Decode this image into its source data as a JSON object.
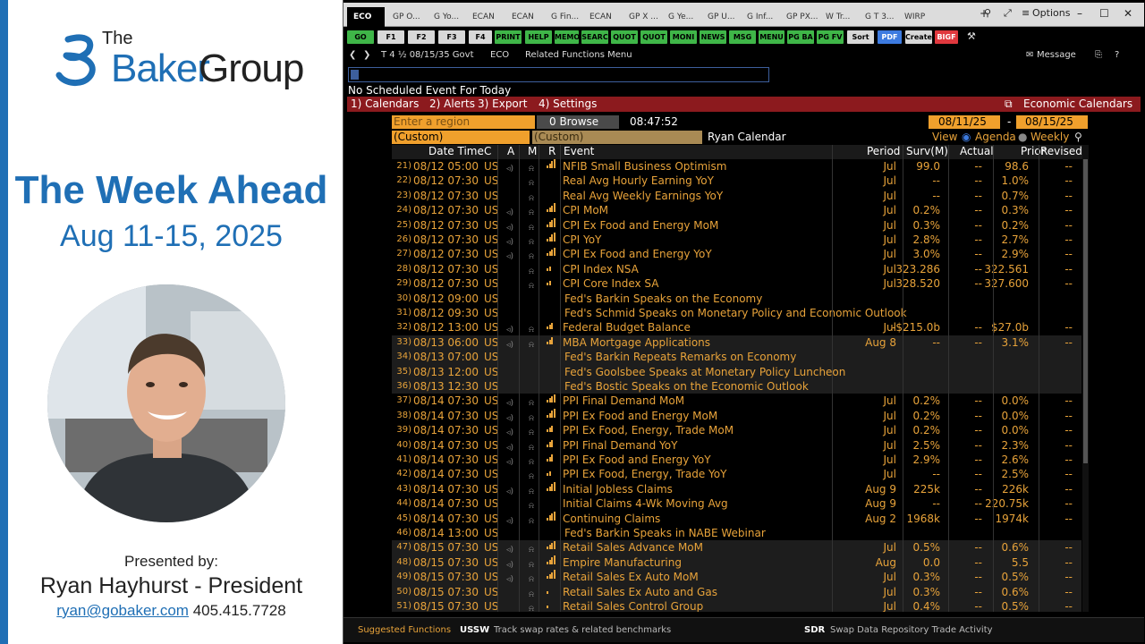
{
  "slide": {
    "logo": {
      "the": "The",
      "baker": "Baker",
      "group": "Group"
    },
    "title": "The Week Ahead",
    "dates": "Aug 11-15, 2025",
    "presented_by": "Presented by:",
    "presenter": "Ryan Hayhurst - President",
    "email": "ryan@gobaker.com",
    "phone": "405.415.7728"
  },
  "terminal": {
    "tabs": [
      "ECO",
      "GP O...",
      "G Yo...",
      "ECAN",
      "ECAN",
      "G Fin...",
      "ECAN",
      "GP X ...",
      "G Ye...",
      "GP U...",
      "G Inf...",
      "GP PX...",
      "W Tr...",
      "G T 3...",
      "WIRP"
    ],
    "options_label": "Options",
    "function_keys": [
      "GO",
      "F1",
      "F2",
      "F3",
      "F4",
      "PRINT",
      "HELP",
      "MEMO",
      "SEARC",
      "QUOT",
      "QUOT",
      "MONI",
      "NEWS",
      "MSG",
      "MENU",
      "PG BA",
      "PG FV",
      "Sort",
      "PDF",
      "Create",
      "BIGF"
    ],
    "nav": {
      "security": "T 4 ½ 08/15/35 Govt",
      "function": "ECO",
      "related": "Related Functions Menu",
      "message": "Message"
    },
    "status_line": "No Scheduled Event For Today",
    "menu": {
      "calendars": "1) Calendars",
      "alerts": "2) Alerts",
      "export": "3) Export",
      "settings": "4) Settings",
      "economic_calendars": "Economic Calendars"
    },
    "region_placeholder": "Enter a region",
    "browse_label": "0 Browse",
    "time": "08:47:52",
    "date_from": "08/11/25",
    "date_to": "08/15/25",
    "custom1": "(Custom)",
    "custom2": "(Custom)",
    "calendar_name": "Ryan Calendar",
    "view_label": "View",
    "agenda_label": "Agenda",
    "weekly_label": "Weekly",
    "columns": {
      "datetime": "Date Time",
      "c": "C",
      "a": "A",
      "m": "M",
      "r": "R",
      "event": "Event",
      "period": "Period",
      "surv": "Surv(M)",
      "actual": "Actual",
      "prior": "Prior",
      "revised": "Revised"
    },
    "rows": [
      {
        "n": "21)",
        "dt": "08/12 05:00",
        "c": "US",
        "ev": "NFIB Small Business Optimism",
        "per": "Jul",
        "sv": "99.0",
        "ac": "--",
        "pr": "98.6",
        "rv": "--",
        "r": 4,
        "shade": false,
        "fed": false
      },
      {
        "n": "22)",
        "dt": "08/12 07:30",
        "c": "US",
        "ev": "Real Avg Hourly Earning YoY",
        "per": "Jul",
        "sv": "--",
        "ac": "--",
        "pr": "1.0%",
        "rv": "--",
        "r": 0,
        "shade": false,
        "fed": false
      },
      {
        "n": "23)",
        "dt": "08/12 07:30",
        "c": "US",
        "ev": "Real Avg Weekly Earnings YoY",
        "per": "Jul",
        "sv": "--",
        "ac": "--",
        "pr": "0.7%",
        "rv": "--",
        "r": 0,
        "shade": false,
        "fed": false
      },
      {
        "n": "24)",
        "dt": "08/12 07:30",
        "c": "US",
        "ev": "CPI MoM",
        "per": "Jul",
        "sv": "0.2%",
        "ac": "--",
        "pr": "0.3%",
        "rv": "--",
        "r": 4,
        "shade": false,
        "fed": false
      },
      {
        "n": "25)",
        "dt": "08/12 07:30",
        "c": "US",
        "ev": "CPI Ex Food and Energy MoM",
        "per": "Jul",
        "sv": "0.3%",
        "ac": "--",
        "pr": "0.2%",
        "rv": "--",
        "r": 4,
        "shade": false,
        "fed": false
      },
      {
        "n": "26)",
        "dt": "08/12 07:30",
        "c": "US",
        "ev": "CPI YoY",
        "per": "Jul",
        "sv": "2.8%",
        "ac": "--",
        "pr": "2.7%",
        "rv": "--",
        "r": 4,
        "shade": false,
        "fed": false
      },
      {
        "n": "27)",
        "dt": "08/12 07:30",
        "c": "US",
        "ev": "CPI Ex Food and Energy YoY",
        "per": "Jul",
        "sv": "3.0%",
        "ac": "--",
        "pr": "2.9%",
        "rv": "--",
        "r": 4,
        "shade": false,
        "fed": false
      },
      {
        "n": "28)",
        "dt": "08/12 07:30",
        "c": "US",
        "ev": "CPI Index NSA",
        "per": "Jul",
        "sv": "323.286",
        "ac": "--",
        "pr": "322.561",
        "rv": "--",
        "r": 2,
        "shade": false,
        "fed": false
      },
      {
        "n": "29)",
        "dt": "08/12 07:30",
        "c": "US",
        "ev": "CPI Core Index SA",
        "per": "Jul",
        "sv": "328.520",
        "ac": "--",
        "pr": "327.600",
        "rv": "--",
        "r": 2,
        "shade": false,
        "fed": false
      },
      {
        "n": "30)",
        "dt": "08/12 09:00",
        "c": "US",
        "ev": "Fed's Barkin Speaks on the Economy",
        "per": "",
        "sv": "",
        "ac": "",
        "pr": "",
        "rv": "",
        "r": 0,
        "shade": false,
        "fed": true
      },
      {
        "n": "31)",
        "dt": "08/12 09:30",
        "c": "US",
        "ev": "Fed's Schmid Speaks on Monetary Policy and Economic Outlook",
        "per": "",
        "sv": "",
        "ac": "",
        "pr": "",
        "rv": "",
        "r": 0,
        "shade": false,
        "fed": true
      },
      {
        "n": "32)",
        "dt": "08/12 13:00",
        "c": "US",
        "ev": "Federal Budget Balance",
        "per": "Jul",
        "sv": "-$215.0b",
        "ac": "--",
        "pr": "$27.0b",
        "rv": "--",
        "r": 3,
        "shade": false,
        "fed": false
      },
      {
        "n": "33)",
        "dt": "08/13 06:00",
        "c": "US",
        "ev": "MBA Mortgage Applications",
        "per": "Aug 8",
        "sv": "--",
        "ac": "--",
        "pr": "3.1%",
        "rv": "--",
        "r": 3,
        "shade": true,
        "fed": false
      },
      {
        "n": "34)",
        "dt": "08/13 07:00",
        "c": "US",
        "ev": "Fed's Barkin Repeats Remarks on Economy",
        "per": "",
        "sv": "",
        "ac": "",
        "pr": "",
        "rv": "",
        "r": 0,
        "shade": true,
        "fed": true
      },
      {
        "n": "35)",
        "dt": "08/13 12:00",
        "c": "US",
        "ev": "Fed's Goolsbee Speaks at Monetary Policy Luncheon",
        "per": "",
        "sv": "",
        "ac": "",
        "pr": "",
        "rv": "",
        "r": 0,
        "shade": true,
        "fed": true
      },
      {
        "n": "36)",
        "dt": "08/13 12:30",
        "c": "US",
        "ev": "Fed's Bostic Speaks on the Economic Outlook",
        "per": "",
        "sv": "",
        "ac": "",
        "pr": "",
        "rv": "",
        "r": 0,
        "shade": true,
        "fed": true
      },
      {
        "n": "37)",
        "dt": "08/14 07:30",
        "c": "US",
        "ev": "PPI Final Demand MoM",
        "per": "Jul",
        "sv": "0.2%",
        "ac": "--",
        "pr": "0.0%",
        "rv": "--",
        "r": 4,
        "shade": false,
        "fed": false
      },
      {
        "n": "38)",
        "dt": "08/14 07:30",
        "c": "US",
        "ev": "PPI Ex Food and Energy MoM",
        "per": "Jul",
        "sv": "0.2%",
        "ac": "--",
        "pr": "0.0%",
        "rv": "--",
        "r": 4,
        "shade": false,
        "fed": false
      },
      {
        "n": "39)",
        "dt": "08/14 07:30",
        "c": "US",
        "ev": "PPI Ex Food, Energy, Trade MoM",
        "per": "Jul",
        "sv": "0.2%",
        "ac": "--",
        "pr": "0.0%",
        "rv": "--",
        "r": 3,
        "shade": false,
        "fed": false
      },
      {
        "n": "40)",
        "dt": "08/14 07:30",
        "c": "US",
        "ev": "PPI Final Demand YoY",
        "per": "Jul",
        "sv": "2.5%",
        "ac": "--",
        "pr": "2.3%",
        "rv": "--",
        "r": 3,
        "shade": false,
        "fed": false
      },
      {
        "n": "41)",
        "dt": "08/14 07:30",
        "c": "US",
        "ev": "PPI Ex Food and Energy YoY",
        "per": "Jul",
        "sv": "2.9%",
        "ac": "--",
        "pr": "2.6%",
        "rv": "--",
        "r": 3,
        "shade": false,
        "fed": false
      },
      {
        "n": "42)",
        "dt": "08/14 07:30",
        "c": "US",
        "ev": "PPI Ex Food, Energy, Trade YoY",
        "per": "Jul",
        "sv": "--",
        "ac": "--",
        "pr": "2.5%",
        "rv": "--",
        "r": 2,
        "shade": false,
        "fed": false
      },
      {
        "n": "43)",
        "dt": "08/14 07:30",
        "c": "US",
        "ev": "Initial Jobless Claims",
        "per": "Aug 9",
        "sv": "225k",
        "ac": "--",
        "pr": "226k",
        "rv": "--",
        "r": 4,
        "shade": false,
        "fed": false
      },
      {
        "n": "44)",
        "dt": "08/14 07:30",
        "c": "US",
        "ev": "Initial Claims 4-Wk Moving Avg",
        "per": "Aug 9",
        "sv": "--",
        "ac": "--",
        "pr": "220.75k",
        "rv": "--",
        "r": 0,
        "shade": false,
        "fed": false
      },
      {
        "n": "45)",
        "dt": "08/14 07:30",
        "c": "US",
        "ev": "Continuing Claims",
        "per": "Aug 2",
        "sv": "1968k",
        "ac": "--",
        "pr": "1974k",
        "rv": "--",
        "r": 4,
        "shade": false,
        "fed": false
      },
      {
        "n": "46)",
        "dt": "08/14 13:00",
        "c": "US",
        "ev": "Fed's Barkin Speaks in NABE Webinar",
        "per": "",
        "sv": "",
        "ac": "",
        "pr": "",
        "rv": "",
        "r": 0,
        "shade": false,
        "fed": true
      },
      {
        "n": "47)",
        "dt": "08/15 07:30",
        "c": "US",
        "ev": "Retail Sales Advance MoM",
        "per": "Jul",
        "sv": "0.5%",
        "ac": "--",
        "pr": "0.6%",
        "rv": "--",
        "r": 4,
        "shade": true,
        "fed": false
      },
      {
        "n": "48)",
        "dt": "08/15 07:30",
        "c": "US",
        "ev": "Empire Manufacturing",
        "per": "Aug",
        "sv": "0.0",
        "ac": "--",
        "pr": "5.5",
        "rv": "--",
        "r": 4,
        "shade": true,
        "fed": false
      },
      {
        "n": "49)",
        "dt": "08/15 07:30",
        "c": "US",
        "ev": "Retail Sales Ex Auto MoM",
        "per": "Jul",
        "sv": "0.3%",
        "ac": "--",
        "pr": "0.5%",
        "rv": "--",
        "r": 4,
        "shade": true,
        "fed": false
      },
      {
        "n": "50)",
        "dt": "08/15 07:30",
        "c": "US",
        "ev": "Retail Sales Ex Auto and Gas",
        "per": "Jul",
        "sv": "0.3%",
        "ac": "--",
        "pr": "0.6%",
        "rv": "--",
        "r": 1,
        "shade": true,
        "fed": false
      },
      {
        "n": "51)",
        "dt": "08/15 07:30",
        "c": "US",
        "ev": "Retail Sales Control Group",
        "per": "Jul",
        "sv": "0.4%",
        "ac": "--",
        "pr": "0.5%",
        "rv": "--",
        "r": 1,
        "shade": true,
        "fed": false
      }
    ],
    "footer": {
      "suggested": "Suggested Functions",
      "f1_code": "USSW",
      "f1_desc": "Track swap rates & related benchmarks",
      "f2_code": "SDR",
      "f2_desc": "Swap Data Repository Trade Activity"
    }
  }
}
